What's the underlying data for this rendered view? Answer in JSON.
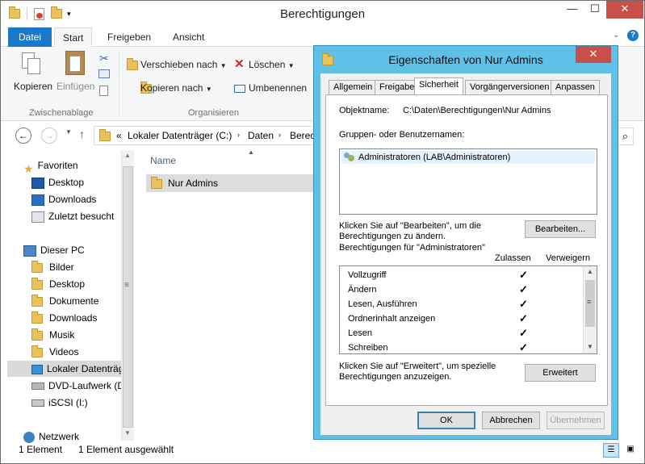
{
  "explorer": {
    "title": "Berechtigungen",
    "window_controls": {
      "minimize": "—",
      "maximize": "☐",
      "close": "✕"
    },
    "tabs": [
      "Datei",
      "Start",
      "Freigeben",
      "Ansicht"
    ],
    "ribbon": {
      "clipboard": {
        "copy": "Kopieren",
        "paste": "Einfügen",
        "group": "Zwischenablage"
      },
      "organize": {
        "move_to": "Verschieben nach",
        "copy_to": "Kopieren nach",
        "delete": "Löschen",
        "rename": "Umbenennen",
        "group": "Organisieren"
      }
    },
    "address": {
      "prefix": "«",
      "crumbs": [
        "Lokaler Datenträger (C:)",
        "Daten",
        "Berec"
      ]
    },
    "nav": {
      "favorites": "Favoriten",
      "fav_items": [
        "Desktop",
        "Downloads",
        "Zuletzt besucht"
      ],
      "this_pc": "Dieser PC",
      "pc_items": [
        "Bilder",
        "Desktop",
        "Dokumente",
        "Downloads",
        "Musik",
        "Videos",
        "Lokaler Datenträg",
        "DVD-Laufwerk (D",
        "iSCSI (I:)"
      ],
      "network": "Netzwerk"
    },
    "column_header": "Name",
    "files": [
      "Nur Admins"
    ],
    "status": {
      "count": "1 Element",
      "selected": "1 Element ausgewählt"
    }
  },
  "dialog": {
    "title": "Eigenschaften von Nur Admins",
    "close": "✕",
    "tabs": [
      "Allgemein",
      "Freigabe",
      "Sicherheit",
      "Vorgängerversionen",
      "Anpassen"
    ],
    "object_label": "Objektname:",
    "object_path": "C:\\Daten\\Berechtigungen\\Nur Admins",
    "groups_label": "Gruppen- oder Benutzernamen:",
    "groups": [
      "Administratoren (LAB\\Administratoren)"
    ],
    "edit_hint_1": "Klicken Sie auf \"Bearbeiten\", um die",
    "edit_hint_2": "Berechtigungen zu ändern.",
    "edit_button": "Bearbeiten...",
    "perm_for": "Berechtigungen für \"Administratoren\"",
    "allow": "Zulassen",
    "deny": "Verweigern",
    "permissions": [
      {
        "name": "Vollzugriff",
        "allow": "✓"
      },
      {
        "name": "Ändern",
        "allow": "✓"
      },
      {
        "name": "Lesen, Ausführen",
        "allow": "✓"
      },
      {
        "name": "Ordnerinhalt anzeigen",
        "allow": "✓"
      },
      {
        "name": "Lesen",
        "allow": "✓"
      },
      {
        "name": "Schreiben",
        "allow": "✓"
      }
    ],
    "adv_hint_1": "Klicken Sie auf \"Erweitert\", um spezielle",
    "adv_hint_2": "Berechtigungen anzuzeigen.",
    "advanced_button": "Erweitert",
    "ok": "OK",
    "cancel": "Abbrechen",
    "apply": "Übernehmen"
  },
  "colors": {
    "file_tab": "#1979ca",
    "dialog_frame": "#5fc0e8",
    "close_red": "#c7504a",
    "selection": "#e5f3ff"
  }
}
